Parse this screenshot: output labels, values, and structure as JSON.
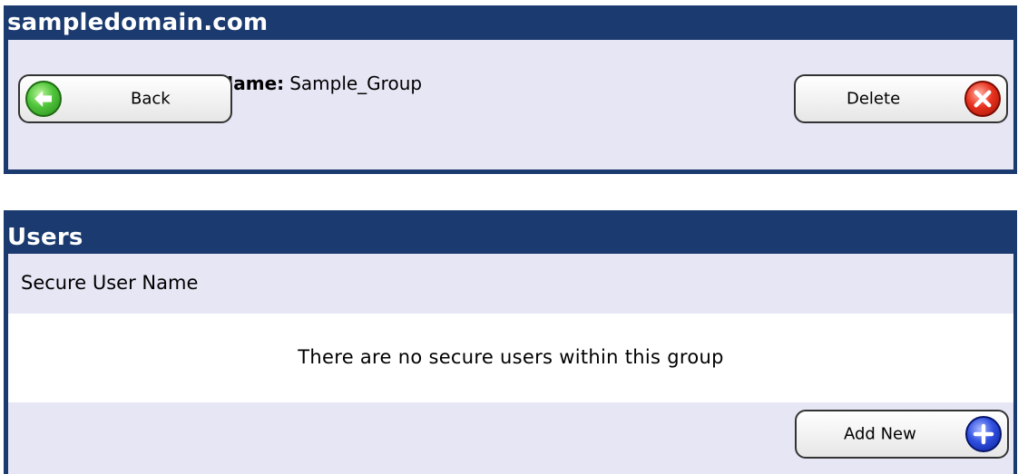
{
  "domain_panel": {
    "title": "sampledomain.com",
    "group_label": "Group Name:",
    "group_value": "Sample_Group",
    "back_label": "Back",
    "delete_label": "Delete",
    "back_icon": "arrow-left-icon",
    "delete_icon": "close-icon"
  },
  "users_panel": {
    "title": "Users",
    "column_header": "Secure User Name",
    "empty_message": "There are no secure users within this group",
    "add_new_label": "Add New",
    "add_icon": "plus-icon"
  },
  "colors": {
    "header_bg": "#1b3a6f",
    "body_bg": "#e6e6f5",
    "back_icon": "#4fc43a",
    "delete_icon": "#e8321e",
    "add_icon": "#2f4fe0"
  }
}
